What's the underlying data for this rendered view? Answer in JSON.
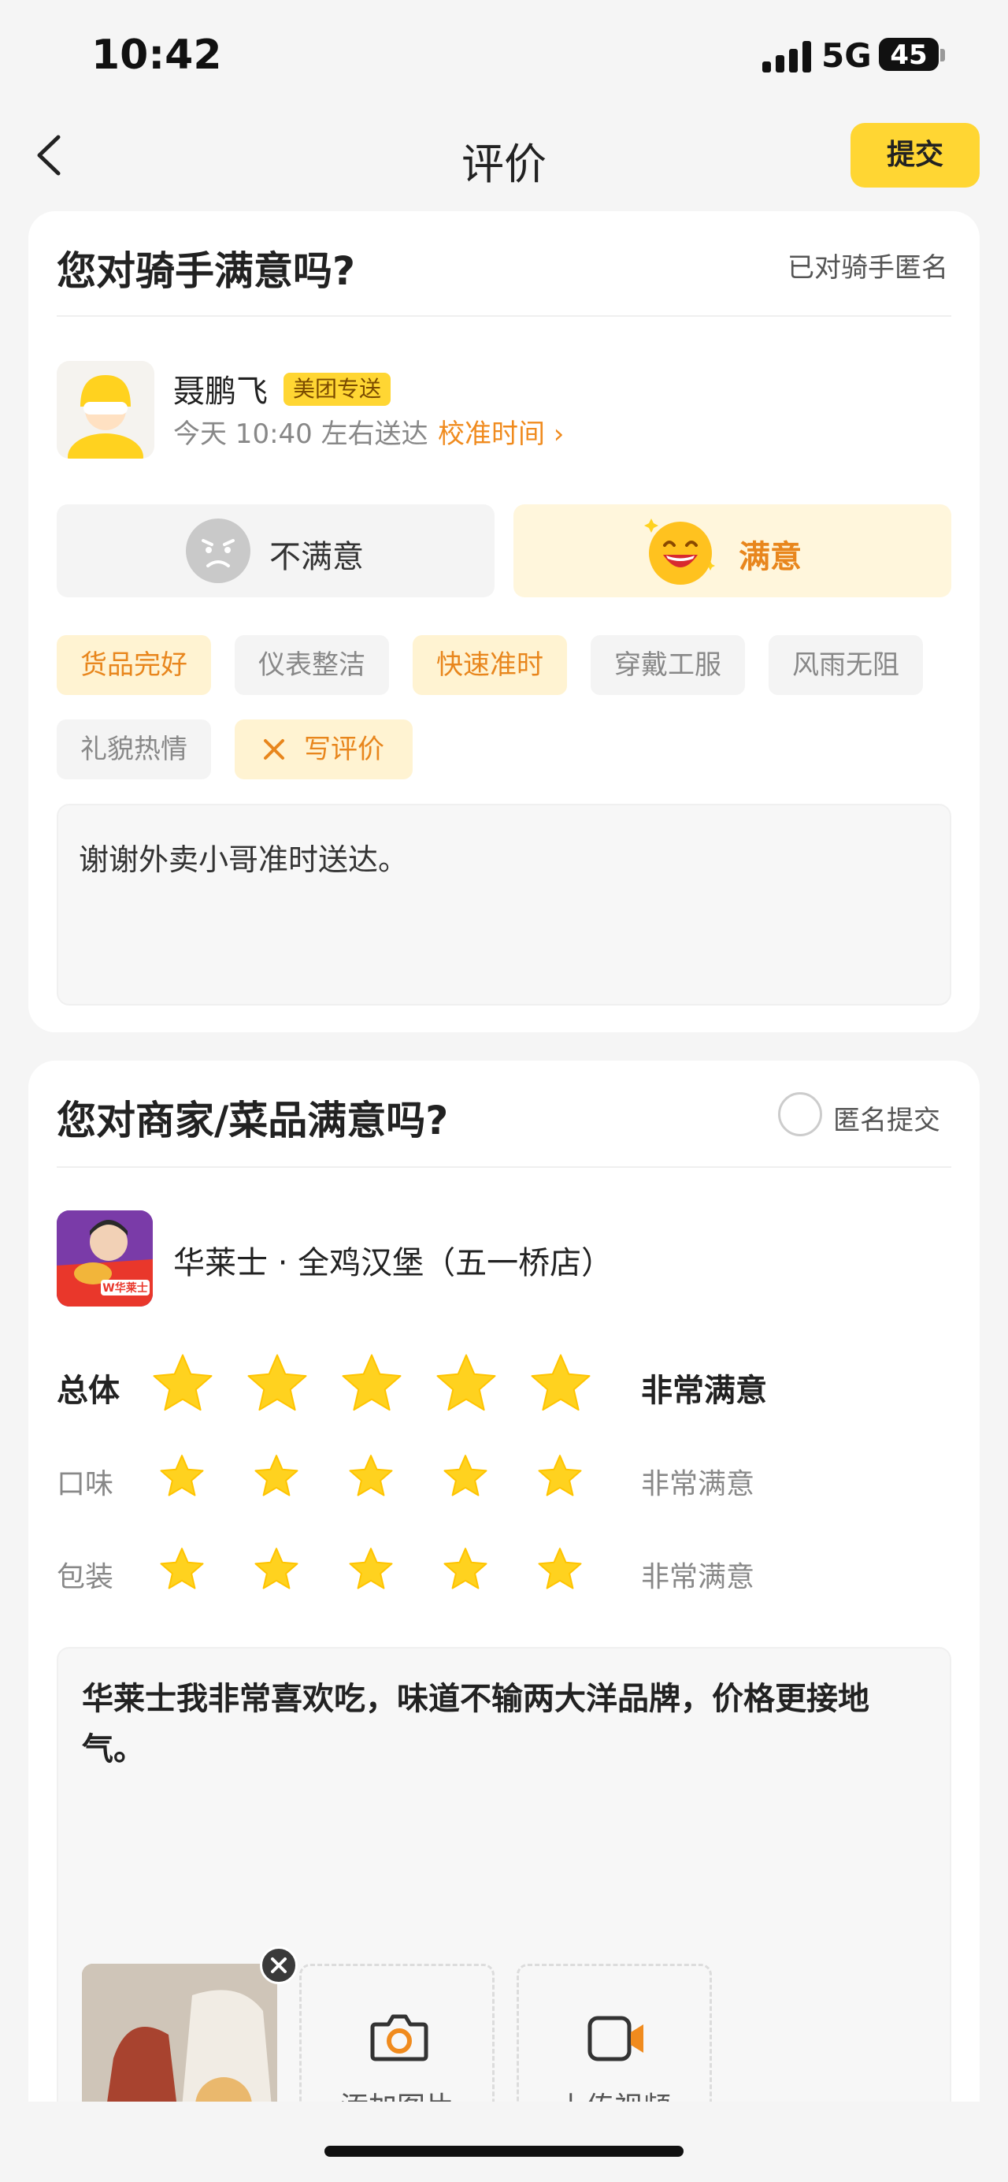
{
  "status_bar": {
    "time": "10:42",
    "network": "5G",
    "battery": "45"
  },
  "nav": {
    "title": "评价",
    "submit_label": "提交"
  },
  "rider_section": {
    "title": "您对骑手满意吗?",
    "anonymous_label": "已对骑手匿名",
    "rider": {
      "name": "聂鹏飞",
      "badge": "美团专送",
      "delivery_time": "今天 10:40 左右送达",
      "adjust_label": "校准时间 ›"
    },
    "choices": {
      "bad": "不满意",
      "good": "满意",
      "selected": "good"
    },
    "tags": [
      {
        "label": "货品完好",
        "selected": true
      },
      {
        "label": "仪表整洁",
        "selected": false
      },
      {
        "label": "快速准时",
        "selected": true
      },
      {
        "label": "穿戴工服",
        "selected": false
      },
      {
        "label": "风雨无阻",
        "selected": false
      },
      {
        "label": "礼貌热情",
        "selected": false
      }
    ],
    "write_review_label": "写评价",
    "comment": "谢谢外卖小哥准时送达。"
  },
  "shop_section": {
    "title": "您对商家/菜品满意吗?",
    "anonymous_label": "匿名提交",
    "shop_name": "华莱士 · 全鸡汉堡（五一桥店）",
    "logo_text": "W华莱士",
    "ratings": [
      {
        "label": "总体",
        "stars": 5,
        "max": 5,
        "word": "非常满意"
      },
      {
        "label": "口味",
        "stars": 5,
        "max": 5,
        "word": "非常满意"
      },
      {
        "label": "包装",
        "stars": 5,
        "max": 5,
        "word": "非常满意"
      }
    ],
    "review_text": "华莱士我非常喜欢吃，味道不输两大洋品牌，价格更接地气。",
    "upload": {
      "add_photo": "添加图片",
      "upload_video": "上传视频"
    }
  },
  "colors": {
    "accent": "#ffd633",
    "tag_text": "#e8861d",
    "star": "#ffd21f"
  }
}
